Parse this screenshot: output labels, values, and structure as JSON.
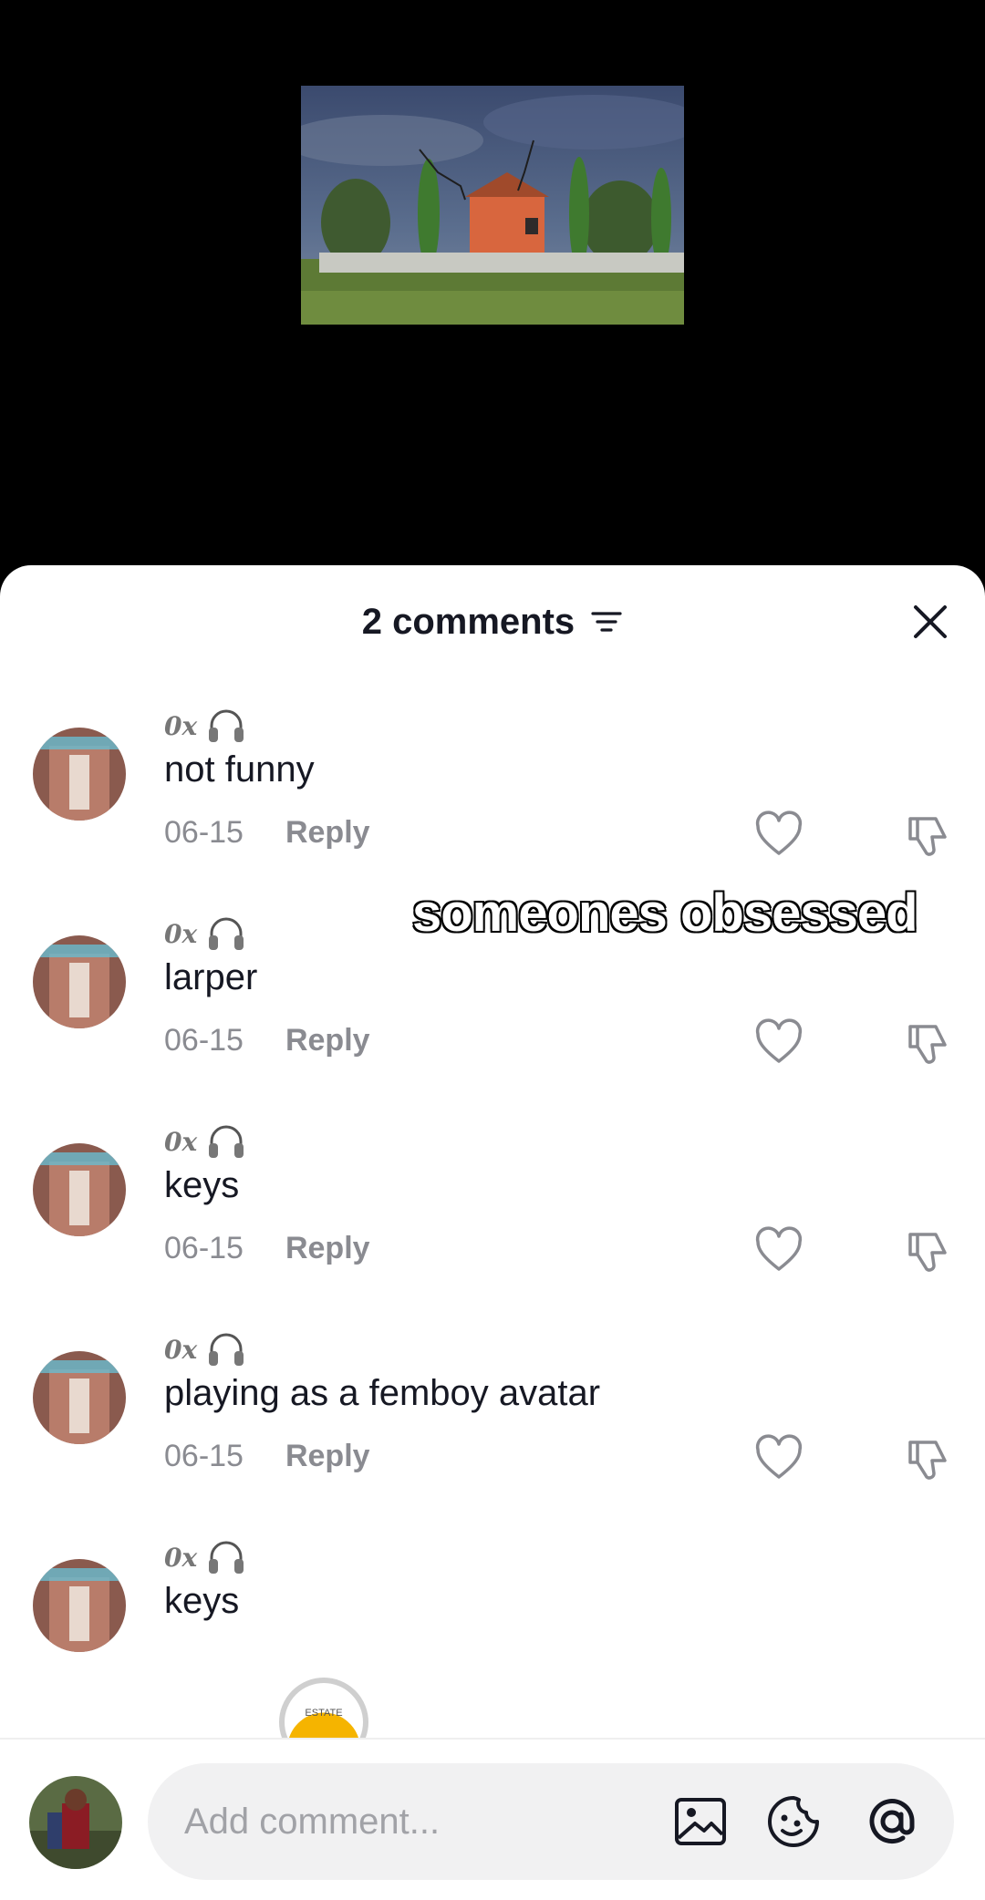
{
  "header": {
    "comments_count_label": "2 comments"
  },
  "overlay_caption": "someones obsessed",
  "comments": [
    {
      "username": "0x",
      "text": "not funny",
      "date": "06-15",
      "reply_label": "Reply"
    },
    {
      "username": "0x",
      "text": "larper",
      "date": "06-15",
      "reply_label": "Reply"
    },
    {
      "username": "0x",
      "text": "keys",
      "date": "06-15",
      "reply_label": "Reply"
    },
    {
      "username": "0x",
      "text": "playing as a femboy avatar",
      "date": "06-15",
      "reply_label": "Reply"
    },
    {
      "username": "0x",
      "text": "keys"
    }
  ],
  "badge": {
    "label": "ESTATE"
  },
  "composer": {
    "placeholder": "Add comment..."
  },
  "icons": {
    "sort": "sort-lines-icon",
    "close": "close-icon",
    "like": "heart-outline-icon",
    "dislike": "thumbs-down-icon",
    "headphones": "headphones-icon",
    "image": "image-icon",
    "sticker": "sticker-face-icon",
    "mention": "at-sign-icon"
  }
}
